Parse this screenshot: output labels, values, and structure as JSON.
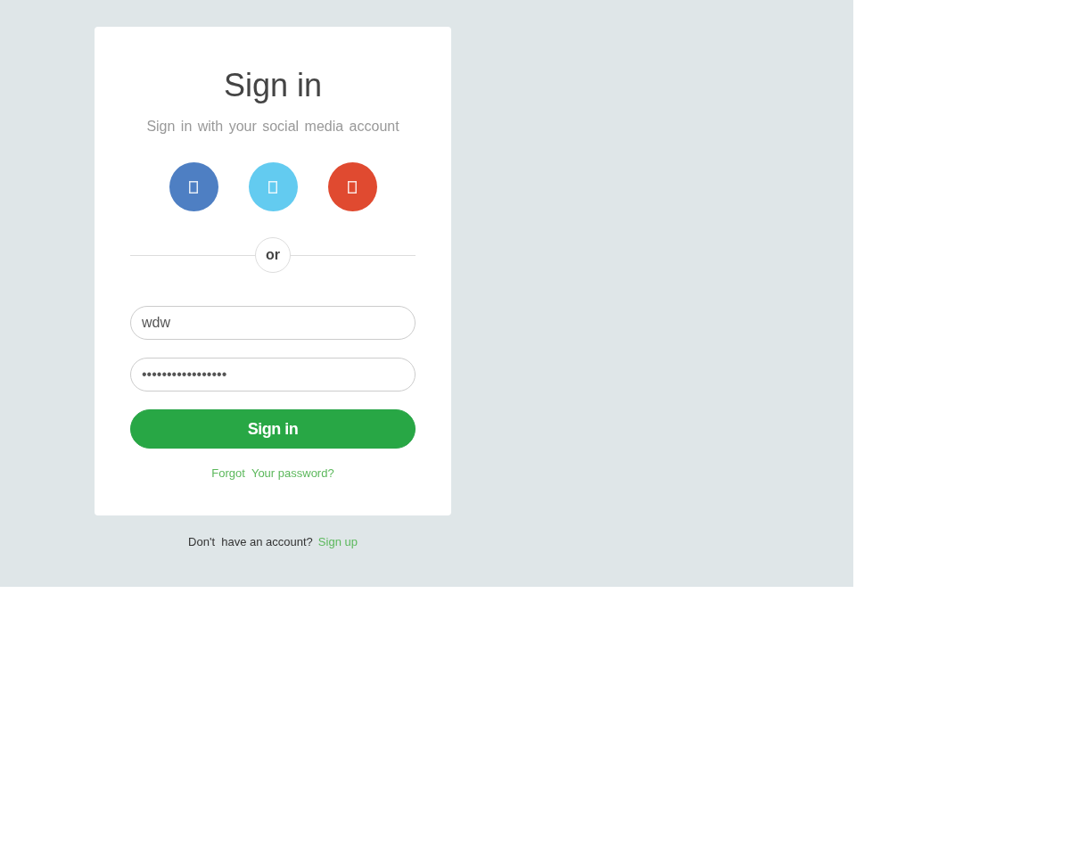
{
  "title": "Sign in",
  "subtitle": "Sign in with your social media account",
  "social_buttons": [
    {
      "color": "#4e7fc3"
    },
    {
      "color": "#63cbf0"
    },
    {
      "color": "#e04a30"
    }
  ],
  "divider": {
    "label": "or"
  },
  "username": {
    "value": "wdw"
  },
  "password": {
    "value": "•••••••••••••••••"
  },
  "submit": {
    "label": "Sign in"
  },
  "forgot_link": "Forgot  Your password?",
  "footer": {
    "text": "Don't  have an account?",
    "link": "Sign up"
  }
}
